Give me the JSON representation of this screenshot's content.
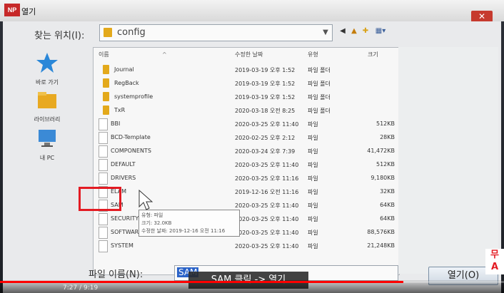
{
  "window": {
    "title": "열기",
    "app_badge": "NP"
  },
  "toolbar": {
    "look_in_label": "찾는 위치(I):",
    "look_in_value": "config"
  },
  "places": [
    {
      "label": "바로 가기"
    },
    {
      "label": "라이브러리"
    },
    {
      "label": "내 PC"
    }
  ],
  "columns": {
    "name": "이름",
    "date": "수정한 날짜",
    "type": "유형",
    "size": "크기"
  },
  "files": [
    {
      "name": "Journal",
      "date": "2019-03-19 오후 1:52",
      "type": "파일 폴더",
      "size": "",
      "kind": "folder"
    },
    {
      "name": "RegBack",
      "date": "2019-03-19 오후 1:52",
      "type": "파일 폴더",
      "size": "",
      "kind": "folder"
    },
    {
      "name": "systemprofile",
      "date": "2019-03-19 오후 1:52",
      "type": "파일 폴더",
      "size": "",
      "kind": "folder"
    },
    {
      "name": "TxR",
      "date": "2020-03-18 오전 8:25",
      "type": "파일 폴더",
      "size": "",
      "kind": "folder"
    },
    {
      "name": "BBI",
      "date": "2020-03-25 오후 11:40",
      "type": "파일",
      "size": "512KB",
      "kind": "file"
    },
    {
      "name": "BCD-Template",
      "date": "2020-02-25 오후 2:12",
      "type": "파일",
      "size": "28KB",
      "kind": "file"
    },
    {
      "name": "COMPONENTS",
      "date": "2020-03-24 오후 7:39",
      "type": "파일",
      "size": "41,472KB",
      "kind": "file"
    },
    {
      "name": "DEFAULT",
      "date": "2020-03-25 오후 11:40",
      "type": "파일",
      "size": "512KB",
      "kind": "file"
    },
    {
      "name": "DRIVERS",
      "date": "2020-03-25 오후 11:16",
      "type": "파일",
      "size": "9,180KB",
      "kind": "file"
    },
    {
      "name": "ELAM",
      "date": "2019-12-16 오전 11:16",
      "type": "파일",
      "size": "32KB",
      "kind": "file"
    },
    {
      "name": "SAM",
      "date": "2020-03-25 오후 11:40",
      "type": "파일",
      "size": "64KB",
      "kind": "file"
    },
    {
      "name": "SECURITY",
      "date": "2020-03-25 오후 11:40",
      "type": "파일",
      "size": "64KB",
      "kind": "file"
    },
    {
      "name": "SOFTWARE",
      "date": "2020-03-25 오후 11:40",
      "type": "파일",
      "size": "88,576KB",
      "kind": "file"
    },
    {
      "name": "SYSTEM",
      "date": "2020-03-25 오후 11:40",
      "type": "파일",
      "size": "21,248KB",
      "kind": "file"
    }
  ],
  "tooltip": {
    "line1": "유형: 파일",
    "line2": "크기: 32.0KB",
    "line3": "수정한 날짜: 2019-12-16 오전 11:16"
  },
  "footer": {
    "filename_label": "파일 이름(N):",
    "filename_value": "SAM",
    "open_button": "열기(O)"
  },
  "overlay": {
    "caption": "SAM 클릭 -> 열기",
    "badge": "무 A"
  },
  "video": {
    "time": "7:27 / 9:19",
    "progress": 0.8
  }
}
